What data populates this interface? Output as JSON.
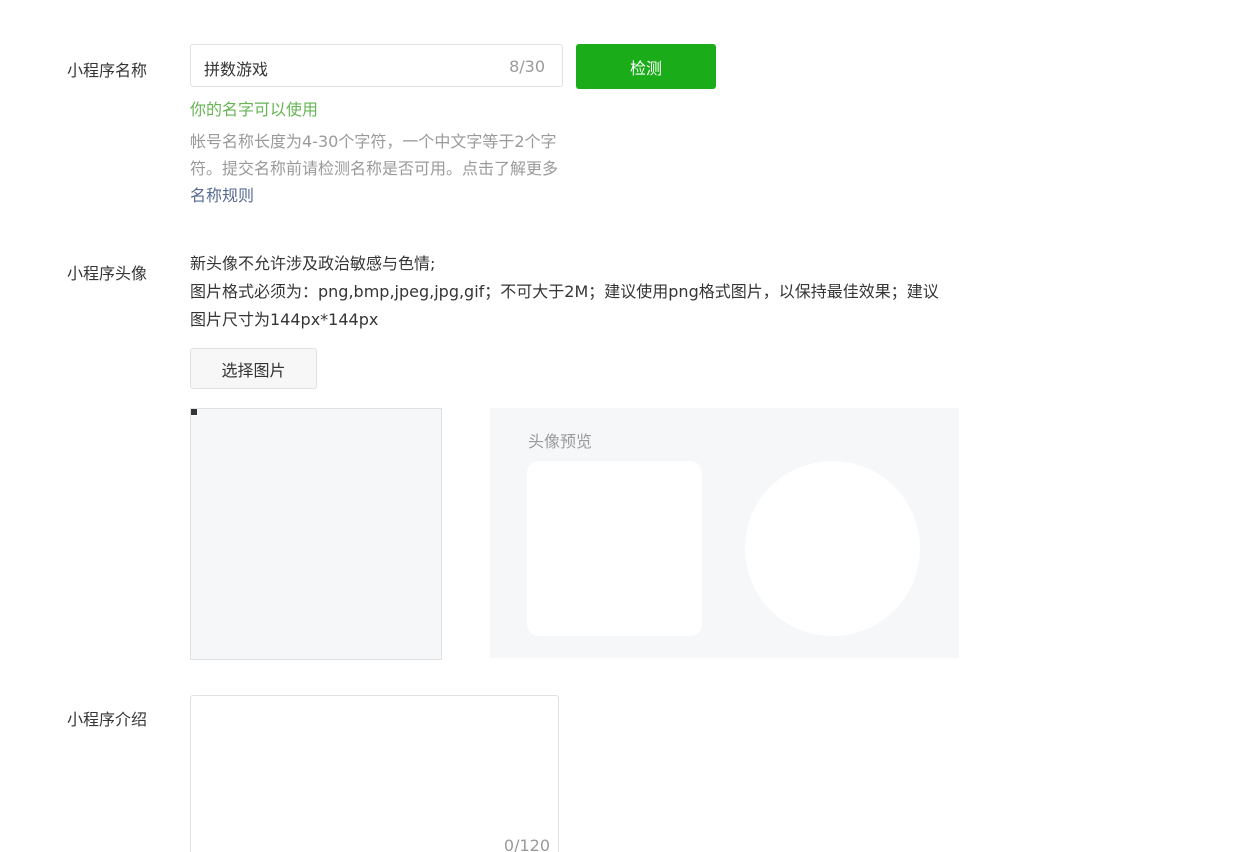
{
  "name_row": {
    "label": "小程序名称",
    "input_value": "拼数游戏",
    "counter": "8/30",
    "check_button": "检测",
    "status_ok": "你的名字可以使用",
    "tip_text": "帐号名称长度为4-30个字符，一个中文字等于2个字符。提交名称前请检测名称是否可用。点击了解更多",
    "tip_link": "名称规则"
  },
  "avatar_row": {
    "label": "小程序头像",
    "desc_line1": "新头像不允许涉及政治敏感与色情;",
    "desc_line2": "图片格式必须为：png,bmp,jpeg,jpg,gif；不可大于2M；建议使用png格式图片，以保持最佳效果；建议图片尺寸为144px*144px",
    "choose_button": "选择图片",
    "preview_title": "头像预览"
  },
  "intro_row": {
    "label": "小程序介绍",
    "counter": "0/120"
  },
  "colors": {
    "primary_green": "#1aad19",
    "ok_green": "#65b553",
    "link_blue": "#576b95"
  }
}
